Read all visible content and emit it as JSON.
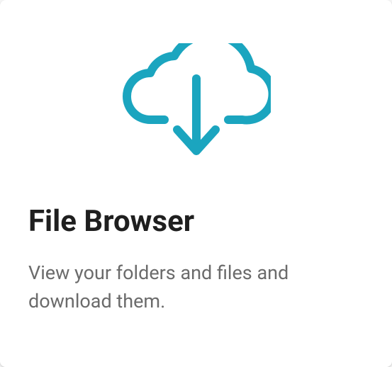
{
  "card": {
    "title": "File Browser",
    "description": "View your folders and files and download them.",
    "icon_color": "#1ba5bf"
  }
}
